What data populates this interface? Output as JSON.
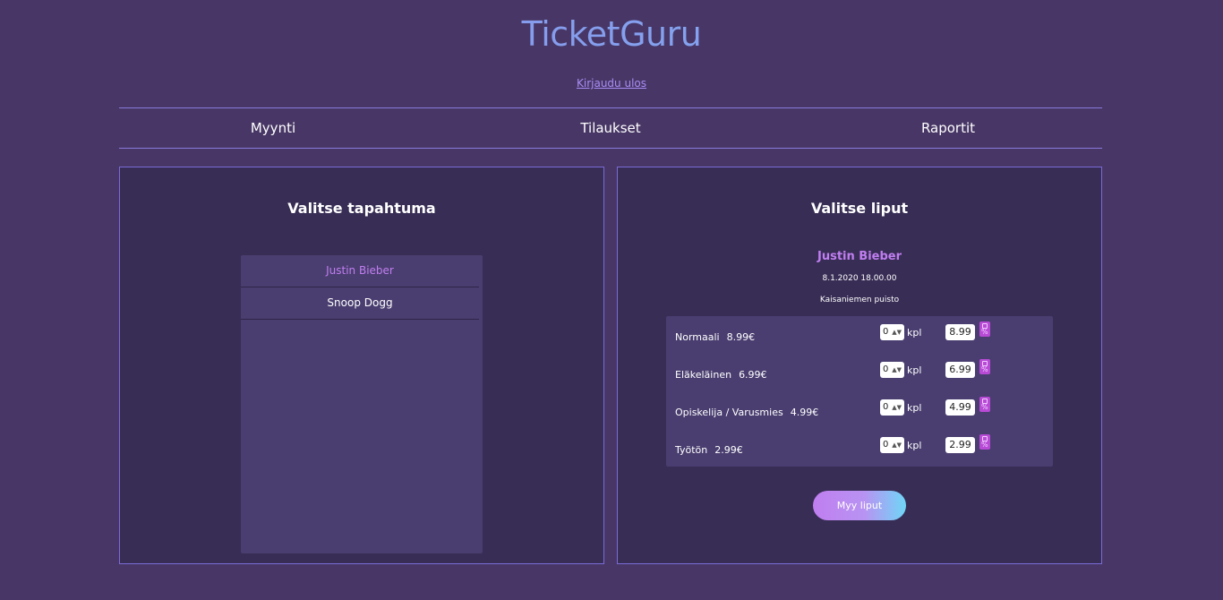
{
  "app": {
    "title": "TicketGuru",
    "logout_label": "Kirjaudu ulos"
  },
  "nav": {
    "tabs": [
      {
        "label": "Myynti"
      },
      {
        "label": "Tilaukset"
      },
      {
        "label": "Raportit"
      }
    ]
  },
  "events_panel": {
    "heading": "Valitse tapahtuma",
    "events": [
      {
        "name": "Justin Bieber",
        "selected": true
      },
      {
        "name": "Snoop Dogg",
        "selected": false
      }
    ]
  },
  "tickets_panel": {
    "heading": "Valitse liput",
    "event_name": "Justin Bieber",
    "event_datetime": "8.1.2020 18.00.00",
    "event_venue": "Kaisaniemen puisto",
    "ticket_types": [
      {
        "name": "Normaali",
        "price": "8.99€",
        "quantity": "0",
        "unit": "kpl",
        "sum": "8.99",
        "icon": "discount-tag-icon"
      },
      {
        "name": "Eläkeläinen",
        "price": "6.99€",
        "quantity": "0",
        "unit": "kpl",
        "sum": "6.99",
        "icon": "discount-tag-icon"
      },
      {
        "name": "Opiskelija / Varusmies",
        "price": "4.99€",
        "quantity": "0",
        "unit": "kpl",
        "sum": "4.99",
        "icon": "discount-tag-icon"
      },
      {
        "name": "Työtön",
        "price": "2.99€",
        "quantity": "0",
        "unit": "kpl",
        "sum": "2.99",
        "icon": "discount-tag-icon"
      }
    ],
    "sell_button_label": "Myy liput"
  },
  "colors": {
    "background": "#483766",
    "panel": "#382d55",
    "accent": "#c07ef0",
    "border": "#8878d9"
  }
}
